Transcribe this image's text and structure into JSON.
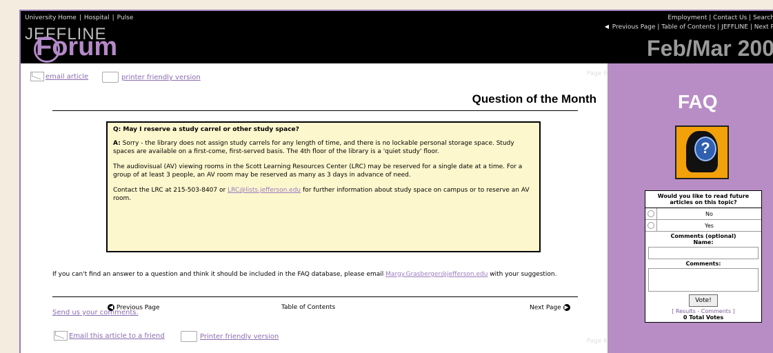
{
  "header": {
    "top_links": [
      "University Home",
      "Hospital",
      "Pulse"
    ],
    "right_links": [
      "Employment",
      "Contact Us",
      "Search"
    ],
    "nav_links": [
      "Previous Page",
      "Table of Contents",
      "JEFFLINE",
      "Next P"
    ],
    "site_name": "JEFFLINE",
    "forum_label": "Forum",
    "issue_date": "Feb/Mar 200"
  },
  "content": {
    "page_marker_top": "Page 6",
    "page_marker_bottom": "Page 6",
    "email_article": "email article",
    "printer_friendly": "printer friendly version",
    "section_title": "Question of the Month",
    "question": "Q: May I reserve a study carrel or other study space?",
    "answer_label": "A:",
    "answer_p1": "Sorry - the library does not assign study carrels for any length of time, and there is no lockable personal storage space. Study spaces are available on a first-come, first-served basis. The 4th floor of the library is a 'quiet study' floor.",
    "answer_p2": "The audiovisual (AV) viewing rooms in the Scott Learning Resources Center (LRC) may be reserved for a single date at a time. For a group of at least 3 people, an AV room may be reserved as many as 3 days in advance of need.",
    "answer_p3_before": "Contact the LRC at 215-503-8407 or",
    "answer_p3_link": "LRC@lists.jefferson.edu",
    "answer_p3_after": "for further information about study space on campus or to reserve an AV room.",
    "faq_text_before": "If you can't find an answer to a question and think it should be included in the FAQ database, please email",
    "faq_text_link": "Margy.Grasberger@jefferson.edu",
    "faq_text_after": "with your suggestion.",
    "send_comments": "Send us your comments.",
    "email_friend": "Email this article to a friend",
    "printer_friendly_2": "Printer friendly version",
    "prev_page": "Previous Page",
    "toc": "Table of Contents",
    "next_page": "Next Page"
  },
  "sidebar": {
    "faq_title": "FAQ",
    "faq_icon_glyph": "?",
    "poll": {
      "question": "Would you like to read future articles on this topic?",
      "options": [
        "No",
        "Yes"
      ],
      "comments_heading": "Comments (optional)",
      "name_label": "Name:",
      "comments_label": "Comments:",
      "vote_button": "Vote!",
      "results_links": "[ Results - Comments ]",
      "total_votes": "0 Total Votes"
    }
  },
  "colors": {
    "accent_purple": "#b88dc5",
    "link_purple": "#8a6bb0",
    "question_box_bg": "#fdf7cd"
  }
}
